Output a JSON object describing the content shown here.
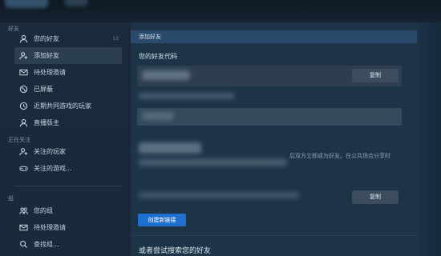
{
  "sidebar": {
    "friends_header": "好友",
    "items": [
      {
        "label": "您的好友",
        "icon": "person-icon",
        "count": "13"
      },
      {
        "label": "添加好友",
        "icon": "add-person-icon"
      },
      {
        "label": "待处理邀请",
        "icon": "mail-icon"
      },
      {
        "label": "已屏蔽",
        "icon": "block-icon"
      },
      {
        "label": "近期共同游戏的玩家",
        "icon": "clock-icon"
      },
      {
        "label": "直播版主",
        "icon": "person-icon"
      }
    ],
    "following_header": "正在关注",
    "following_items": [
      {
        "label": "关注的玩家",
        "icon": "add-person-icon"
      },
      {
        "label": "关注的游戏...",
        "icon": "gamepad-icon"
      }
    ],
    "groups_header": "组",
    "group_items": [
      {
        "label": "您的组",
        "icon": "group-icon"
      },
      {
        "label": "待处理邀请",
        "icon": "mail-icon"
      },
      {
        "label": "查找组...",
        "icon": "search-icon"
      }
    ]
  },
  "main": {
    "header": "添加好友",
    "friend_code_label": "您的好友代码",
    "copy_label": "复制",
    "copy_label_2": "复制",
    "create_link_label": "创建新链接",
    "note_text": "后双方立即成为好友。在公共场合分享时",
    "search_label": "或者尝试搜索您的好友"
  },
  "colors": {
    "accent": "#1f6fcf",
    "background": "#1b2838"
  }
}
